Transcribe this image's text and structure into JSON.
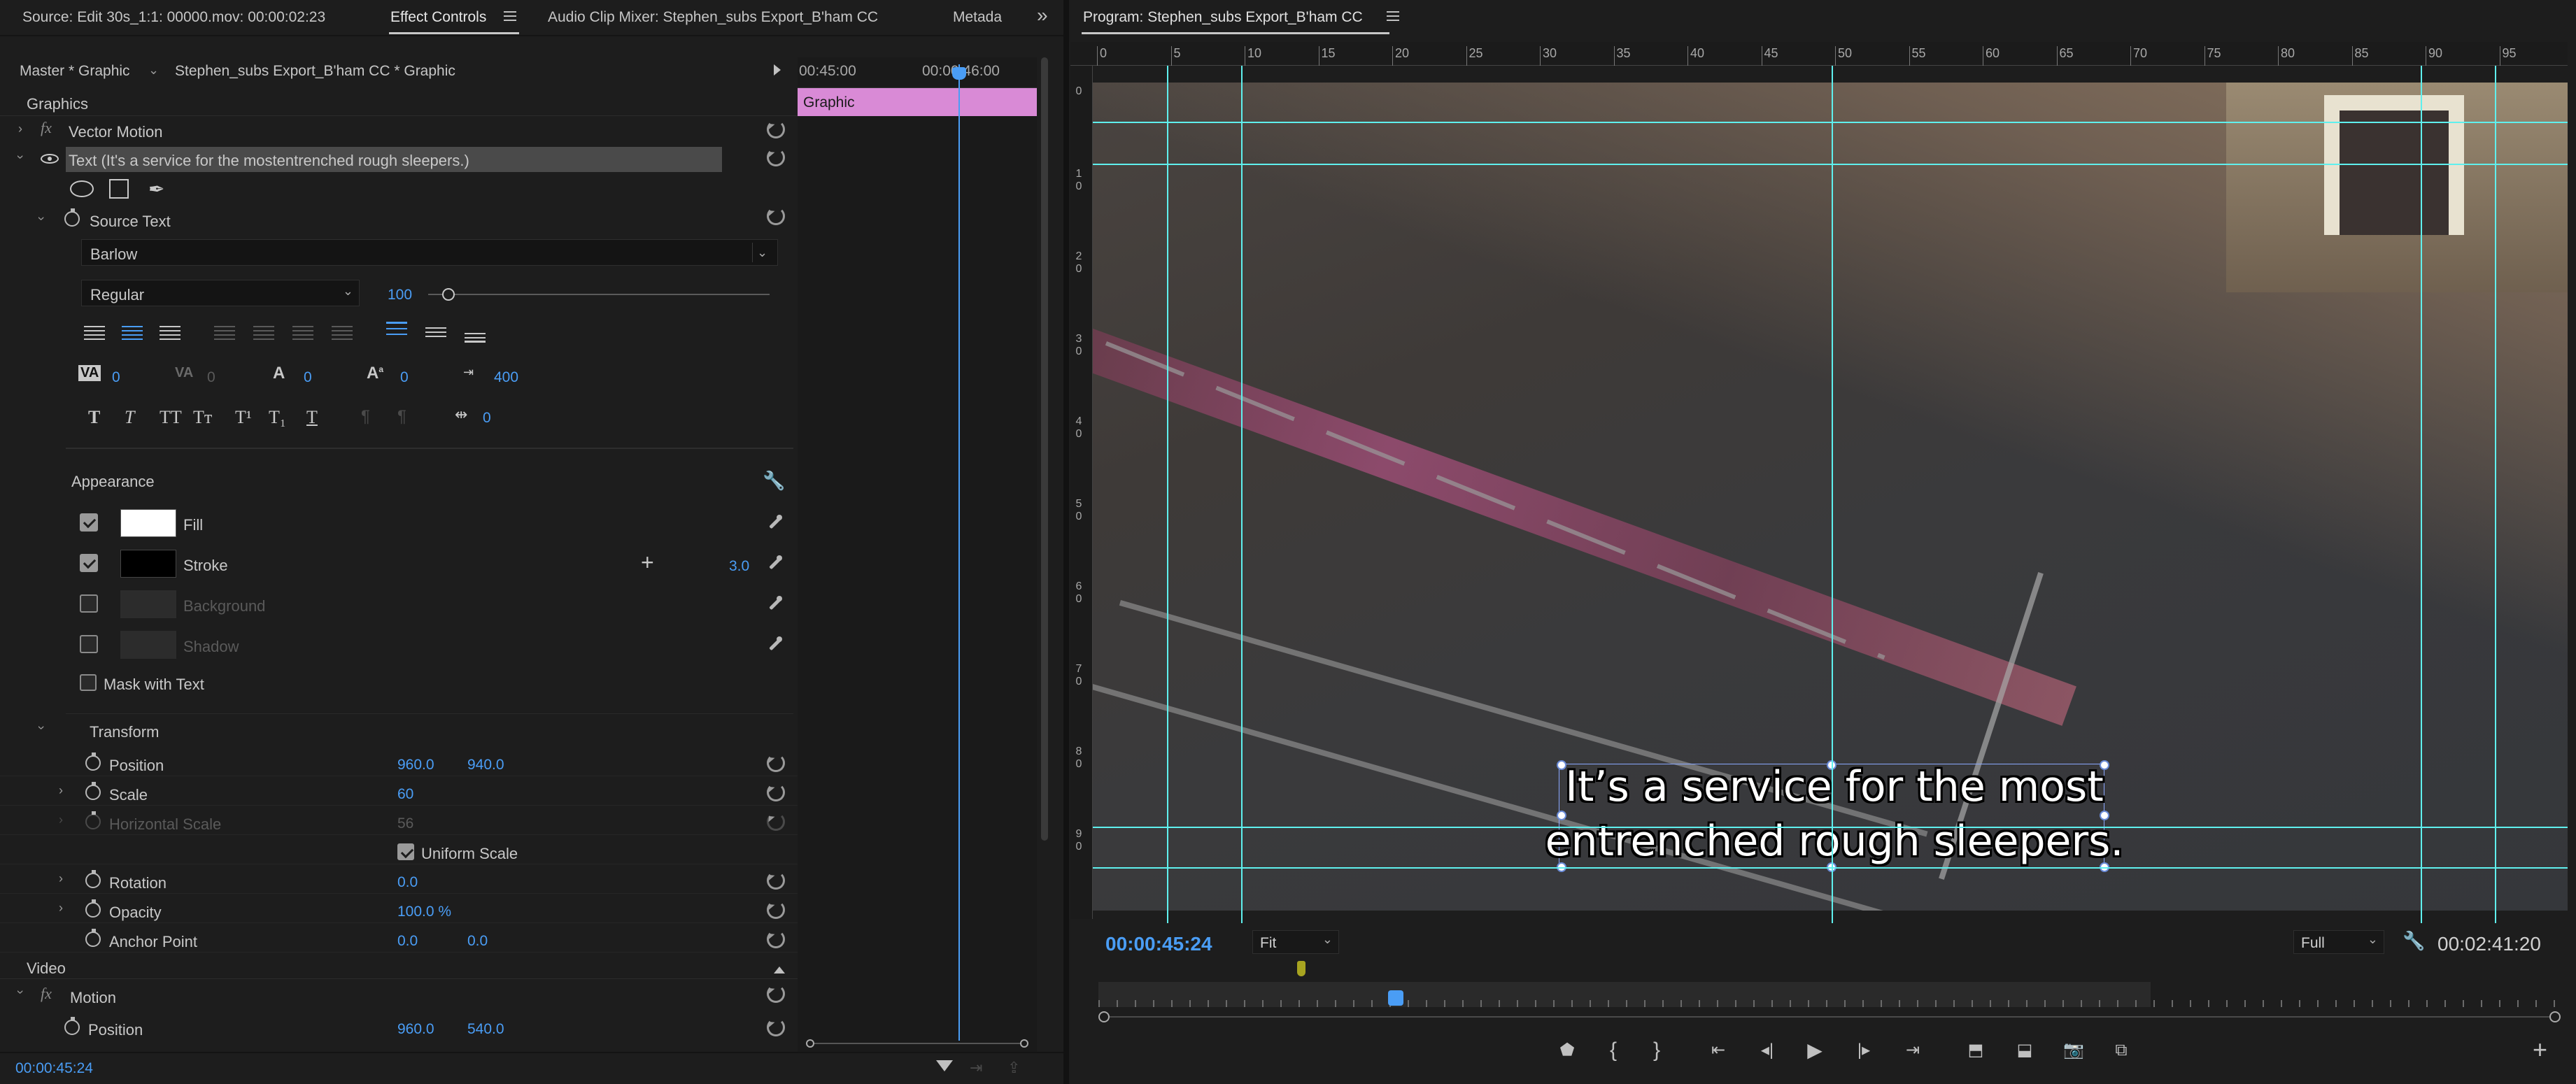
{
  "tabs_left": {
    "source": "Source: Edit 30s_1:1: 00000.mov: 00:00:02:23",
    "effect_controls": "Effect Controls",
    "audio_mixer": "Audio Clip Mixer: Stephen_subs Export_B'ham CC",
    "metadata": "Metada"
  },
  "clip_bar": {
    "master": "Master * Graphic",
    "sequence": "Stephen_subs Export_B'ham CC  * Graphic"
  },
  "mini_timeline": {
    "t1": "00:45:00",
    "t2": "00:00:46:00",
    "clip": "Graphic"
  },
  "graphics_section": "Graphics",
  "vector_motion": "Vector Motion",
  "text_layer": "Text (It's a service for the mostentrenched rough sleepers.)",
  "source_text": "Source Text",
  "font_family": "Barlow",
  "font_style": "Regular",
  "font_size": "100",
  "typo": {
    "tracking": "0",
    "kerning": "0",
    "leading": "0",
    "baseline": "0",
    "tsume": "400",
    "indent": "0"
  },
  "typo_buttons": {
    "b1": "T",
    "b2": "T",
    "b3": "TT",
    "b4": "Tт",
    "b5": "T¹",
    "b6": "T₁",
    "b7": "T"
  },
  "appearance": {
    "title": "Appearance",
    "fill": "Fill",
    "fill_color": "#ffffff",
    "stroke": "Stroke",
    "stroke_color": "#000000",
    "stroke_width": "3.0",
    "background": "Background",
    "shadow": "Shadow",
    "mask": "Mask with Text"
  },
  "transform": {
    "title": "Transform",
    "position": "Position",
    "pos_x": "960.0",
    "pos_y": "940.0",
    "scale": "Scale",
    "scale_val": "60",
    "hscale": "Horizontal Scale",
    "hscale_val": "56",
    "uniform": "Uniform Scale",
    "rotation": "Rotation",
    "rotation_val": "0.0",
    "opacity": "Opacity",
    "opacity_val": "100.0 %",
    "anchor": "Anchor Point",
    "anchor_x": "0.0",
    "anchor_y": "0.0"
  },
  "video": {
    "title": "Video",
    "motion": "Motion",
    "position": "Position",
    "pos_x": "960.0",
    "pos_y": "540.0"
  },
  "left_timecode": "00:00:45:24",
  "program": {
    "title": "Program: Stephen_subs Export_B'ham CC",
    "ruler": [
      "0",
      "5",
      "10",
      "15",
      "20",
      "25",
      "30",
      "35",
      "40",
      "45",
      "50",
      "55",
      "60",
      "65",
      "70",
      "75",
      "80",
      "85",
      "90",
      "95"
    ],
    "vruler": [
      "0",
      "1 0",
      "2 0",
      "3 0",
      "4 0",
      "5 0",
      "6 0",
      "7 0",
      "8 0",
      "9 0"
    ],
    "caption_line1": "It’s a service for the most",
    "caption_line2": "entrenched rough sleepers.",
    "timecode": "00:00:45:24",
    "fit": "Fit",
    "quality": "Full",
    "duration": "00:02:41:20"
  },
  "colors": {
    "accent": "#4a9df5",
    "guides": "#5ff0ee",
    "clip": "#d98ad6"
  }
}
